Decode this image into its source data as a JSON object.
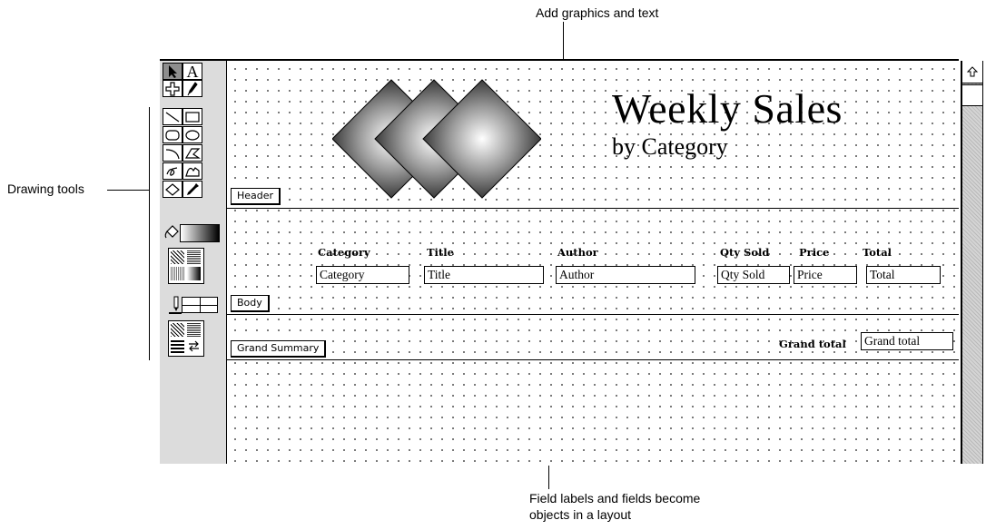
{
  "callouts": {
    "graphics": "Add graphics and text",
    "tools": "Drawing tools",
    "fields_line1": "Field labels and fields become",
    "fields_line2": "objects in a layout"
  },
  "layout_title": "Weekly Sales",
  "layout_subtitle": "by Category",
  "parts": {
    "header": "Header",
    "body": "Body",
    "summary": "Grand Summary"
  },
  "field_labels": {
    "category": "Category",
    "title": "Title",
    "author": "Author",
    "qty_sold": "Qty Sold",
    "price": "Price",
    "total": "Total",
    "grand_total": "Grand total"
  },
  "fields": {
    "category": "Category",
    "title": "Title",
    "author": "Author",
    "qty_sold": "Qty Sold",
    "price": "Price",
    "total": "Total",
    "grand_total": "Grand total"
  },
  "tools": {
    "text_glyph": "A",
    "pointer": "pointer-icon",
    "text": "text-tool-icon",
    "field": "field-tool-icon",
    "button": "button-tool-icon"
  }
}
